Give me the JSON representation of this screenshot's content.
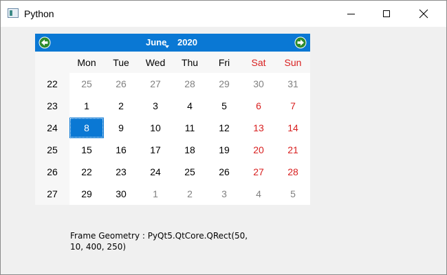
{
  "window": {
    "title": "Python"
  },
  "calendar": {
    "month": "June",
    "year": "2020",
    "weekdays": [
      "Mon",
      "Tue",
      "Wed",
      "Thu",
      "Fri",
      "Sat",
      "Sun"
    ],
    "week_numbers": [
      "22",
      "23",
      "24",
      "25",
      "26",
      "27"
    ],
    "rows": [
      [
        "25",
        "26",
        "27",
        "28",
        "29",
        "30",
        "31"
      ],
      [
        "1",
        "2",
        "3",
        "4",
        "5",
        "6",
        "7"
      ],
      [
        "8",
        "9",
        "10",
        "11",
        "12",
        "13",
        "14"
      ],
      [
        "15",
        "16",
        "17",
        "18",
        "19",
        "20",
        "21"
      ],
      [
        "22",
        "23",
        "24",
        "25",
        "26",
        "27",
        "28"
      ],
      [
        "29",
        "30",
        "1",
        "2",
        "3",
        "4",
        "5"
      ]
    ],
    "selected_day": "8",
    "colors": {
      "accent": "#0a78d4",
      "weekend": "#d81e1e",
      "other_month": "#808080"
    }
  },
  "label": {
    "text": "Frame Geometry : PyQt5.QtCore.QRect(50, 10, 400, 250)"
  },
  "icons": {
    "app": "python-window-icon",
    "minimize": "minimize-icon",
    "maximize": "maximize-icon",
    "close": "close-icon",
    "prev": "arrow-left-icon",
    "next": "arrow-right-icon",
    "month_menu": "chevron-down-icon"
  }
}
